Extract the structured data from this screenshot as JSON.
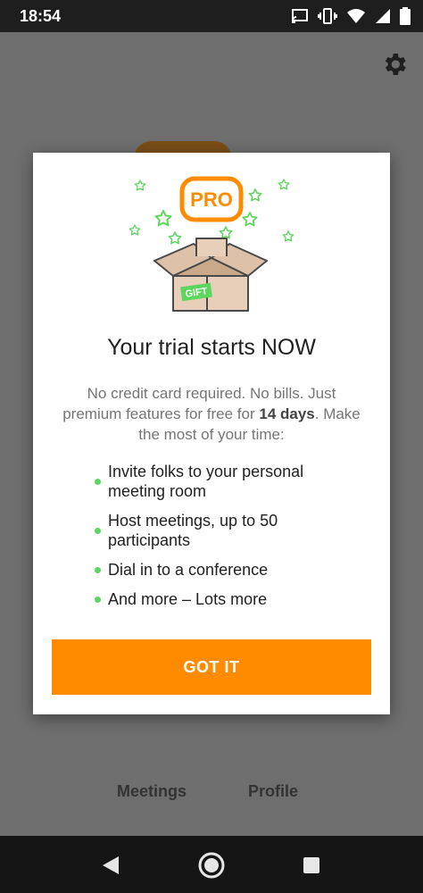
{
  "status_bar": {
    "time": "18:54"
  },
  "background": {
    "tabs": [
      "Meetings",
      "Profile"
    ]
  },
  "dialog": {
    "badge": "PRO",
    "gift_tag": "GIFT",
    "title": "Your trial starts NOW",
    "desc_before": "No credit card required. No bills. Just premium features for free for ",
    "desc_bold": "14 days",
    "desc_after": ". Make the most of your time:",
    "features": [
      [
        "Invite folks to your personal",
        "meeting room"
      ],
      [
        "Host meetings, up to 50",
        "participants"
      ],
      [
        "Dial in to a conference"
      ],
      [
        "And more – Lots more"
      ]
    ],
    "button": "GOT IT"
  },
  "colors": {
    "accent": "#ff8c00",
    "star": "#5cd65c",
    "dot": "#5cd65c"
  }
}
